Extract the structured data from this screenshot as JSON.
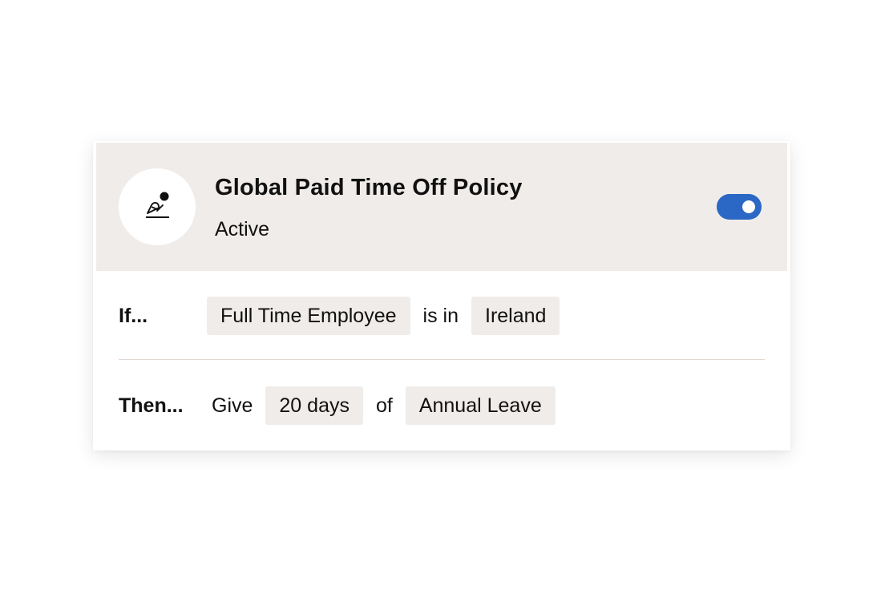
{
  "policy": {
    "icon": "leave-person-icon",
    "title": "Global Paid Time Off Policy",
    "status": "Active",
    "enabled": true,
    "toggle_color": "#2b67c4",
    "header_bg": "#f0ece9"
  },
  "condition": {
    "label": "If...",
    "subject": "Full Time Employee",
    "operator": "is in",
    "value": "Ireland"
  },
  "action": {
    "label": "Then...",
    "verb": "Give",
    "amount": "20 days",
    "connector": "of",
    "leave_type": "Annual Leave"
  }
}
